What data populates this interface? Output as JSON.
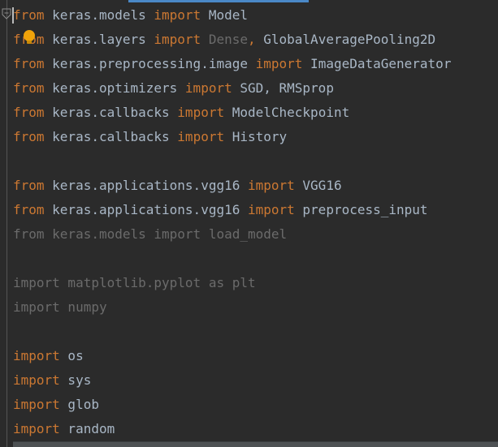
{
  "colors": {
    "background": "#2b2b2b",
    "keyword": "#cc7832",
    "identifier": "#a9b7c6",
    "unused": "#6b6b6b",
    "tab_accent": "#4a88c7",
    "bulb": "#f0a30a"
  },
  "icons": {
    "fold": "fold-marker-icon",
    "bulb": "intention-bulb-icon"
  },
  "lines": [
    {
      "kw1": "from",
      "mod": " keras.models ",
      "kw2": "import",
      "names": " Model"
    },
    {
      "kw1": "from",
      "mod": " keras.layers ",
      "kw2": "import",
      "unused_name": " Dense",
      "comma": ",",
      "names": " GlobalAveragePooling2D"
    },
    {
      "kw1": "from",
      "mod": " keras.preprocessing.image ",
      "kw2": "import",
      "names": " ImageDataGenerator"
    },
    {
      "kw1": "from",
      "mod": " keras.optimizers ",
      "kw2": "import",
      "names": " SGD, RMSprop"
    },
    {
      "kw1": "from",
      "mod": " keras.callbacks ",
      "kw2": "import",
      "names": " ModelCheckpoint"
    },
    {
      "kw1": "from",
      "mod": " keras.callbacks ",
      "kw2": "import",
      "names": " History"
    },
    {
      "kw1": "from",
      "mod": " keras.applications.vgg16 ",
      "kw2": "import",
      "names": " VGG16"
    },
    {
      "kw1": "from",
      "mod": " keras.applications.vgg16 ",
      "kw2": "import",
      "names": " preprocess_input"
    },
    {
      "unused_text": "from keras.models import load_model"
    },
    {
      "unused_text": "import matplotlib.pyplot as plt"
    },
    {
      "unused_text": "import numpy"
    },
    {
      "kw1": "import",
      "names": " os"
    },
    {
      "kw1": "import",
      "names": " sys"
    },
    {
      "kw1": "import",
      "names": " glob"
    },
    {
      "kw1": "import",
      "names": " random"
    }
  ]
}
